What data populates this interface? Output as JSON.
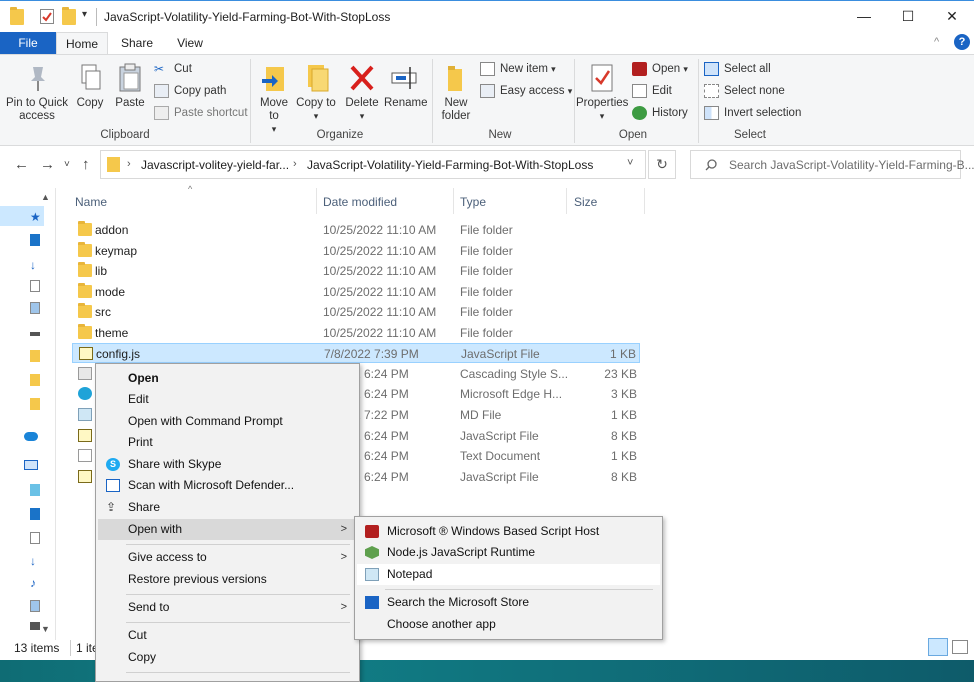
{
  "window": {
    "title": "JavaScript-Volatility-Yield-Farming-Bot-With-StopLoss",
    "minimize": "—",
    "maximize": "☐",
    "close": "✕"
  },
  "ribbon_tabs": {
    "file": "File",
    "home": "Home",
    "share": "Share",
    "view": "View"
  },
  "ribbon": {
    "clipboard": {
      "pin": "Pin to Quick access",
      "copy": "Copy",
      "paste": "Paste",
      "cut": "Cut",
      "copy_path": "Copy path",
      "paste_shortcut": "Paste shortcut",
      "label": "Clipboard"
    },
    "organize": {
      "move_to": "Move to",
      "copy_to": "Copy to",
      "delete": "Delete",
      "rename": "Rename",
      "label": "Organize"
    },
    "new": {
      "new_folder": "New folder",
      "new_item": "New item",
      "easy_access": "Easy access",
      "label": "New"
    },
    "open": {
      "properties": "Properties",
      "open": "Open",
      "edit": "Edit",
      "history": "History",
      "label": "Open"
    },
    "select": {
      "select_all": "Select all",
      "select_none": "Select none",
      "invert": "Invert selection",
      "label": "Select"
    }
  },
  "address": {
    "crumb1": "Javascript-volitey-yield-far...",
    "crumb2": "JavaScript-Volatility-Yield-Farming-Bot-With-StopLoss",
    "search_placeholder": "Search JavaScript-Volatility-Yield-Farming-B..."
  },
  "columns": {
    "name": "Name",
    "date": "Date modified",
    "type": "Type",
    "size": "Size"
  },
  "files": [
    {
      "name": "addon",
      "date": "10/25/2022 11:10 AM",
      "type": "File folder",
      "size": ""
    },
    {
      "name": "keymap",
      "date": "10/25/2022 11:10 AM",
      "type": "File folder",
      "size": ""
    },
    {
      "name": "lib",
      "date": "10/25/2022 11:10 AM",
      "type": "File folder",
      "size": ""
    },
    {
      "name": "mode",
      "date": "10/25/2022 11:10 AM",
      "type": "File folder",
      "size": ""
    },
    {
      "name": "src",
      "date": "10/25/2022 11:10 AM",
      "type": "File folder",
      "size": ""
    },
    {
      "name": "theme",
      "date": "10/25/2022 11:10 AM",
      "type": "File folder",
      "size": ""
    },
    {
      "name": "config.js",
      "date": "7/8/2022 7:39 PM",
      "type": "JavaScript File",
      "size": "1 KB"
    },
    {
      "name": "",
      "date": "2 6:24 PM",
      "type": "Cascading Style S...",
      "size": "23 KB"
    },
    {
      "name": "",
      "date": "2 6:24 PM",
      "type": "Microsoft Edge H...",
      "size": "3 KB"
    },
    {
      "name": "",
      "date": "2 7:22 PM",
      "type": "MD File",
      "size": "1 KB"
    },
    {
      "name": "",
      "date": "2 6:24 PM",
      "type": "JavaScript File",
      "size": "8 KB"
    },
    {
      "name": "",
      "date": "2 6:24 PM",
      "type": "Text Document",
      "size": "1 KB"
    },
    {
      "name": "",
      "date": "2 6:24 PM",
      "type": "JavaScript File",
      "size": "8 KB"
    }
  ],
  "context_menu": {
    "open": "Open",
    "edit": "Edit",
    "open_cmd": "Open with Command Prompt",
    "print": "Print",
    "share_skype": "Share with Skype",
    "scan_defender": "Scan with Microsoft Defender...",
    "share": "Share",
    "open_with": "Open with",
    "give_access": "Give access to",
    "restore": "Restore previous versions",
    "send_to": "Send to",
    "cut": "Cut",
    "copy": "Copy"
  },
  "submenu": {
    "wscript": "Microsoft ® Windows Based Script Host",
    "node": "Node.js JavaScript Runtime",
    "notepad": "Notepad",
    "store": "Search the Microsoft Store",
    "choose": "Choose another app"
  },
  "status": {
    "items": "13 items",
    "selected": "1 ite"
  },
  "colors": {
    "accent": "#1a64c4",
    "selection": "#cce8ff",
    "folder": "#f5c84b"
  }
}
